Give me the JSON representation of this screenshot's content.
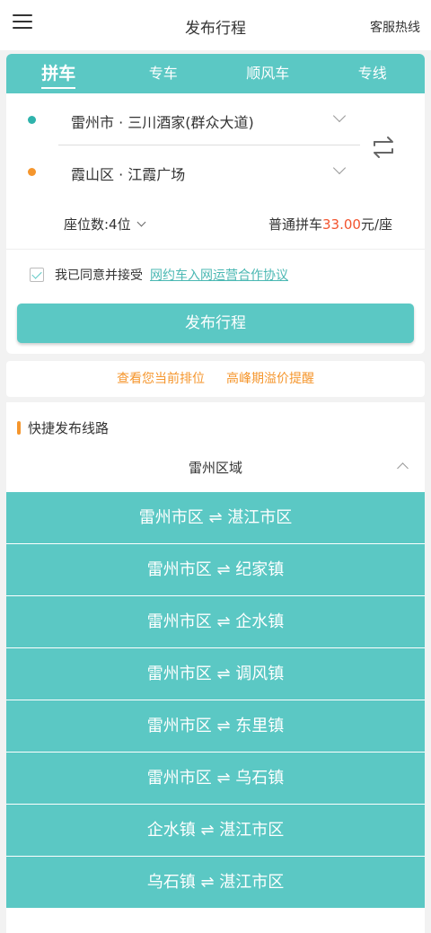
{
  "header": {
    "title": "发布行程",
    "hotline": "客服热线"
  },
  "tabs": [
    "拼车",
    "专车",
    "顺风车",
    "专线"
  ],
  "route": {
    "from": "雷州市 · 三川酒家(群众大道)",
    "to": "霞山区 · 江霞广场"
  },
  "seats": "座位数:4位",
  "price": {
    "prefix": "普通拼车",
    "amount": "33.00",
    "suffix": "元/座"
  },
  "agreement": {
    "text": "我已同意并接受",
    "link": "网约车入网运营合作协议"
  },
  "publish_button": "发布行程",
  "notices": {
    "rank": "查看您当前排位",
    "peak": "高峰期溢价提醒"
  },
  "quick": {
    "title": "快捷发布线路",
    "region": "雷州区域",
    "routes": [
      "雷州市区 ⇌ 湛江市区",
      "雷州市区 ⇌ 纪家镇",
      "雷州市区 ⇌ 企水镇",
      "雷州市区 ⇌ 调风镇",
      "雷州市区 ⇌ 东里镇",
      "雷州市区 ⇌ 乌石镇",
      "企水镇 ⇌ 湛江市区",
      "乌石镇 ⇌ 湛江市区"
    ]
  },
  "colors": {
    "accent": "#5bc8c4",
    "orange": "#f5962d",
    "price": "#f2542f"
  },
  "icons": {
    "menu": "menu-icon",
    "swap": "swap-icon"
  }
}
